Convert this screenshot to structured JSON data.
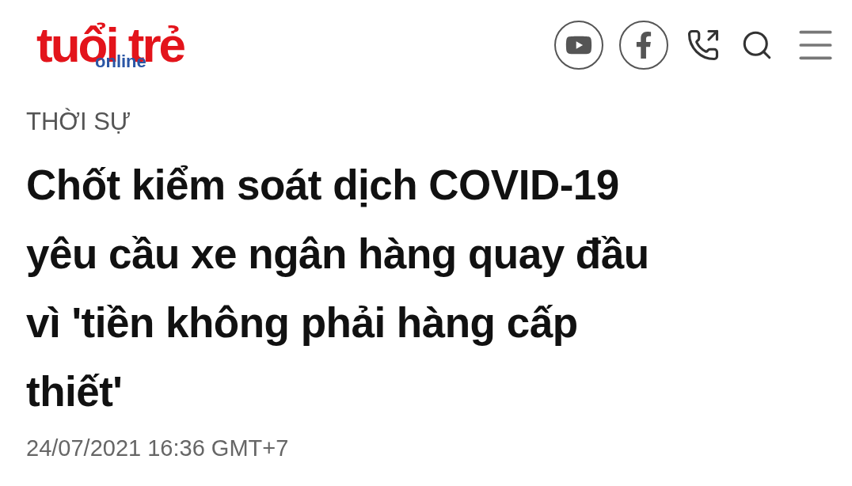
{
  "header": {
    "logo": {
      "main": "tuổi trẻ",
      "sub": "online"
    },
    "actions": [
      {
        "kind": "youtube"
      },
      {
        "kind": "facebook"
      },
      {
        "kind": "phone"
      },
      {
        "kind": "search"
      },
      {
        "kind": "menu"
      }
    ]
  },
  "article": {
    "category": "THỜI SỰ",
    "title_lines": [
      "Chốt kiểm soát dịch COVID-19",
      "yêu cầu xe ngân hàng quay đầu",
      "vì 'tiền không phải hàng cấp",
      "thiết'"
    ],
    "published": "24/07/2021 16:36 GMT+7"
  }
}
